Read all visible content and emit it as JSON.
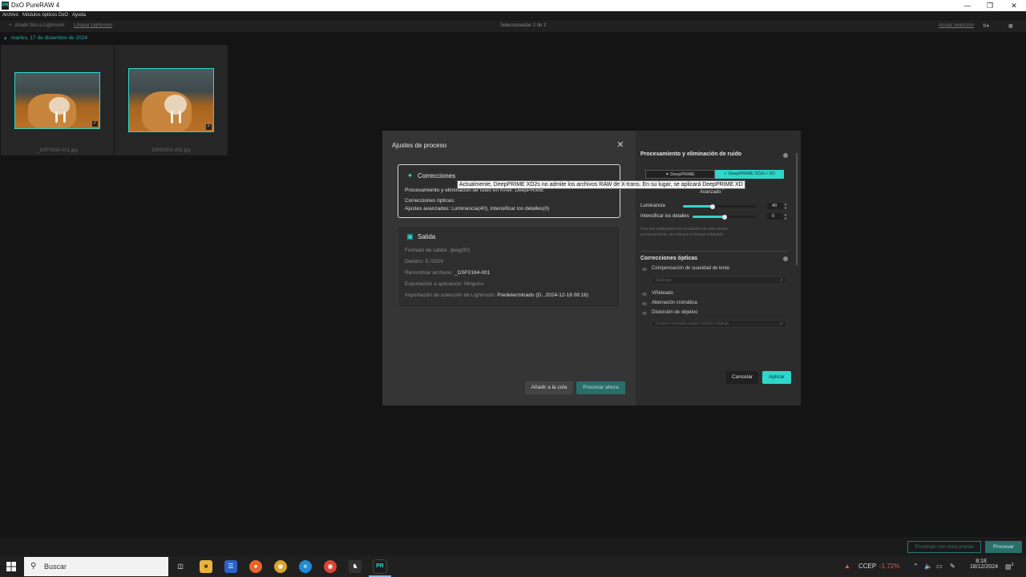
{
  "window": {
    "title": "DxO PureRAW 4",
    "app_icon": "PR"
  },
  "menu": {
    "items": [
      "Archivo",
      "Módulos ópticos DxO",
      "Ayuda"
    ]
  },
  "toolbar": {
    "add_to_lightroom": "Añadir foto a Lightroom",
    "clear_lightroom": "Limpiar Lightroom",
    "selection_status": "Seleccionadas 2 de 2",
    "select_all": "Anular selección"
  },
  "grid": {
    "date_header": "martes, 17 de diciembre de 2024",
    "thumbs": [
      {
        "name": "_DSF0164-001.jpg"
      },
      {
        "name": "DMS0001-002.jpg"
      }
    ]
  },
  "modal": {
    "title": "Ajustes de proceso",
    "corrections": {
      "title": "Correcciones",
      "processing_label": "Procesamiento y eliminación de ruido en RAW:",
      "processing_value": "DeepPRIME",
      "optical_label": "Correcciones ópticas:",
      "advanced_label": "Ajustes avanzados:",
      "advanced_value": "Luminancia(40), Intensificar los detalles(0)"
    },
    "output": {
      "title": "Salida",
      "format_label": "Formato de salida:",
      "format_value": "Jpeg(90)",
      "dest_label": "Destino:",
      "dest_value": "E:/3200",
      "rename_label": "Renombrar archivos:",
      "rename_value": "_DSF0164-001",
      "export_label": "Exportación a aplicación:",
      "export_value": "Ninguno",
      "lr_label": "Importación de colección de Lightroom:",
      "lr_value": "Predeterminado (D...2024-12-18 08:16)"
    },
    "add_queue": "Añadir a la cola",
    "process_now": "Procesar ahora",
    "right": {
      "denoise_title": "Procesamiento y eliminación de ruido",
      "seg_deepprime": "DeepPRIME",
      "seg_xd": "DeepPRIME XD2s / XD",
      "advanced": "Avanzado",
      "luminance_label": "Luminancia",
      "luminance_value": "40",
      "luminance_level": 0.4,
      "details_label": "Intensificar los detalles",
      "details_value": "0",
      "details_level": 0.5,
      "note": "Una vez analizados los resultados de este primer procesamiento, se indicará el tiempo estimado.",
      "optical_title": "Correcciones ópticas",
      "lens_softness": "Compensación de suavidad de lente",
      "lens_dd": "Estándar",
      "vignetting": "Viñeteado",
      "chromatic": "Aberración cromática",
      "distortion": "Distorsión de objetivo",
      "distortion_dd": "Imagen recortada según relación original",
      "cancel": "Cancelar",
      "apply": "Aplicar"
    }
  },
  "tooltip": "Actualmente, DeepPRIME XD2s no admite los archivos RAW de X-trans. En su lugar, se aplicará DeepPRIME XD",
  "procbar": {
    "preview": "Procesar con vista previa",
    "process": "Procesar"
  },
  "taskbar": {
    "search_placeholder": "Buscar",
    "ticker_name": "CCEP",
    "ticker_change": "-1,72%",
    "time": "8:18",
    "date": "18/12/2024",
    "notif_count": "3"
  },
  "colors": {
    "accent": "#2fd6c9",
    "negative": "#e05050"
  }
}
